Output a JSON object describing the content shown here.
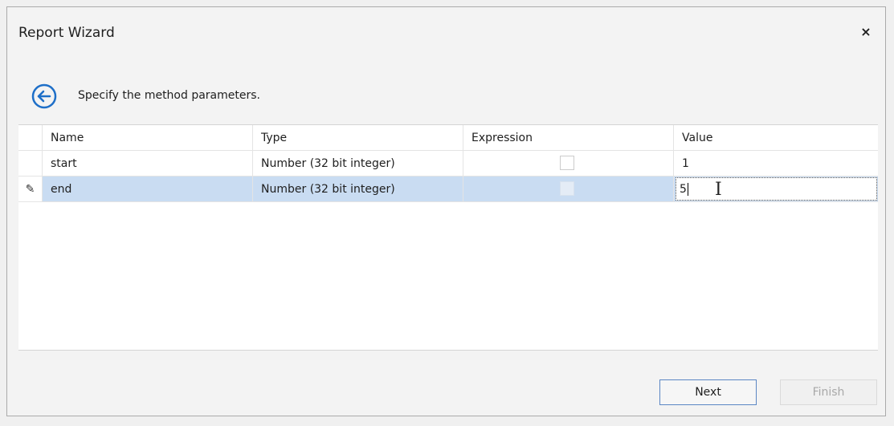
{
  "window": {
    "title": "Report Wizard",
    "close_label": "×"
  },
  "step": {
    "instruction": "Specify the method parameters."
  },
  "grid": {
    "columns": [
      "Name",
      "Type",
      "Expression",
      "Value"
    ],
    "rows": [
      {
        "name": "start",
        "type": "Number (32 bit integer)",
        "expression": false,
        "value": "1"
      },
      {
        "name": "end",
        "type": "Number (32 bit integer)",
        "expression": false,
        "value": "5",
        "editing": true,
        "selected": true
      }
    ],
    "editing_indicator_icon": "pencil-icon"
  },
  "buttons": {
    "next": "Next",
    "finish": "Finish"
  },
  "colors": {
    "accent": "#1e6fc8",
    "selected_row": "#c9dcf2",
    "next_border": "#5b86c4"
  }
}
